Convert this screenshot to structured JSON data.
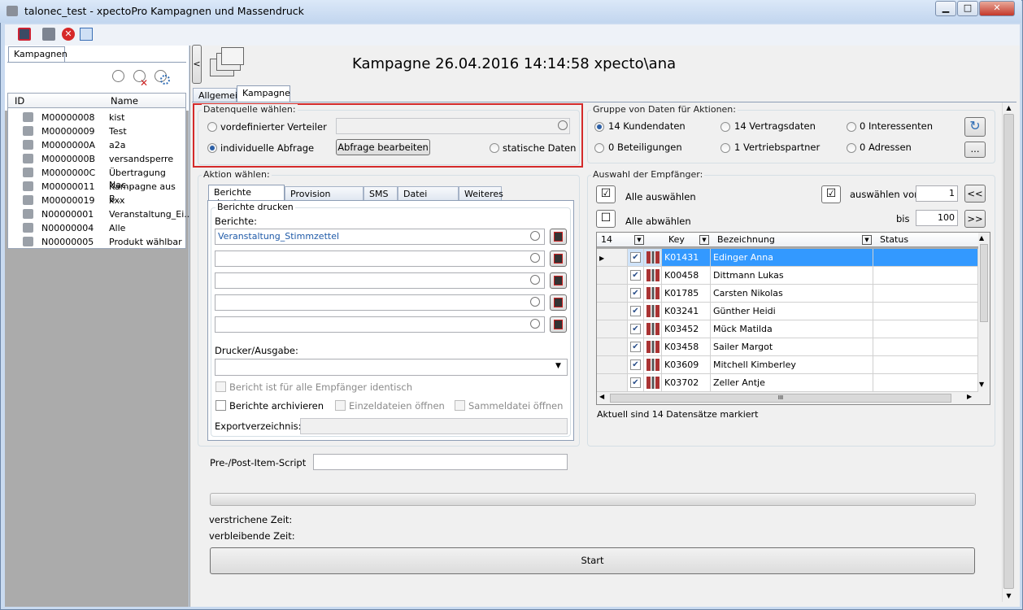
{
  "window": {
    "title": "talonec_test - xpectoPro Kampagnen und Massendruck",
    "minimize": "▁",
    "maximize": "□",
    "close": "✕"
  },
  "left": {
    "tab": "Kampagnen",
    "col_id": "ID",
    "col_name": "Name",
    "rows": [
      {
        "id": "M00000008",
        "name": "kist"
      },
      {
        "id": "M00000009",
        "name": "Test"
      },
      {
        "id": "M0000000A",
        "name": "a2a"
      },
      {
        "id": "M0000000B",
        "name": "versandsperre"
      },
      {
        "id": "M0000000C",
        "name": "Übertragung Nac..."
      },
      {
        "id": "M00000011",
        "name": "Kampagne aus B..."
      },
      {
        "id": "M00000019",
        "name": "xxx"
      },
      {
        "id": "N00000001",
        "name": "Veranstaltung_Ei..."
      },
      {
        "id": "N00000004",
        "name": "Alle"
      },
      {
        "id": "N00000005",
        "name": "Produkt wählbar"
      }
    ]
  },
  "collapse_button": "<",
  "header": {
    "title": "Kampagne 26.04.2016 14:14:58 xpecto\\ana"
  },
  "tabs": {
    "allgemein": "Allgemein",
    "kampagne": "Kampagne"
  },
  "datasource": {
    "label": "Datenquelle wählen:",
    "opt_predefined": "vordefinierter Verteiler",
    "opt_individual": "individuelle Abfrage",
    "edit_query": "Abfrage bearbeiten",
    "opt_static": "statische Daten"
  },
  "groups": {
    "label": "Gruppe von Daten für Aktionen:",
    "items": [
      "14 Kundendaten",
      "14 Vertragsdaten",
      "0 Interessenten",
      "0 Beteiligungen",
      "1 Vertriebspartner",
      "0 Adressen"
    ],
    "more": "..."
  },
  "action": {
    "label": "Aktion wählen:",
    "tabs": [
      "Berichte drucken",
      "Provision einfügen",
      "SMS",
      "Datei Upload",
      "Weiteres"
    ],
    "group_label": "Berichte drucken",
    "reports_label": "Berichte:",
    "reports": [
      "Veranstaltung_Stimmzettel",
      "",
      "",
      "",
      ""
    ],
    "printer_label": "Drucker/Ausgabe:",
    "printer_value": "",
    "identical": "Bericht ist für alle Empfänger identisch",
    "archive": "Berichte archivieren",
    "single_files": "Einzeldateien öffnen",
    "collect_file": "Sammeldatei öffnen",
    "export_label": "Exportverzeichnis:"
  },
  "recipients": {
    "label": "Auswahl der Empfänger:",
    "select_all": "Alle auswählen",
    "deselect_all": "Alle abwählen",
    "select_from": "auswählen von",
    "from_value": "1",
    "to_label": "bis",
    "to_value": "100",
    "prev": "<<",
    "next": ">>",
    "grid_count": "14",
    "col_key": "Key",
    "col_name": "Bezeichnung",
    "col_status": "Status",
    "rows": [
      {
        "key": "K01431",
        "name": "Edinger Anna"
      },
      {
        "key": "K00458",
        "name": "Dittmann Lukas"
      },
      {
        "key": "K01785",
        "name": "Carsten Nikolas"
      },
      {
        "key": "K03241",
        "name": "Günther Heidi"
      },
      {
        "key": "K03452",
        "name": "Mück Matilda"
      },
      {
        "key": "K03458",
        "name": "Sailer Margot"
      },
      {
        "key": "K03609",
        "name": "Mitchell Kimberley"
      },
      {
        "key": "K03702",
        "name": "Zeller Antje"
      }
    ],
    "scroll_mid": "III",
    "status_text": "Aktuell sind 14 Datensätze markiert"
  },
  "script_label": "Pre-/Post-Item-Script",
  "elapsed": "verstrichene Zeit:",
  "remaining": "verbleibende Zeit:",
  "start": "Start"
}
